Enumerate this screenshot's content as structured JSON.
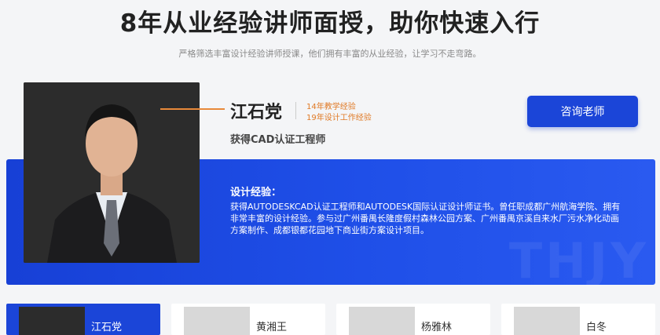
{
  "header": {
    "title": "8年从业经验讲师面授，助你快速入行",
    "subtitle": "严格筛选丰富设计经验讲师授课，他们拥有丰富的从业经验，让学习不走弯路。"
  },
  "featured": {
    "name": "江石党",
    "experience": [
      "14年教学经验",
      "19年设计工作经验"
    ],
    "certification": "获得CAD认证工程师",
    "consult_label": "咨询老师",
    "design_title": "设计经验：",
    "design_text": "获得AUTODESKCAD认证工程师和AUTODESK国际认证设计师证书。曾任职成都广州航海学院、拥有非常丰富的设计经验。参与过广州番禺长隆度假村森林公园方案、广州番禺京溪自来水厂污水净化动画方案制作、成都银都花园地下商业街方案设计项目。",
    "watermark": "THJY"
  },
  "teachers": [
    {
      "name": "江石党"
    },
    {
      "name": "黄湘王"
    },
    {
      "name": "杨雅林"
    },
    {
      "name": "白冬"
    }
  ],
  "colors": {
    "accent": "#1b45d8",
    "highlight": "#e07a26"
  }
}
